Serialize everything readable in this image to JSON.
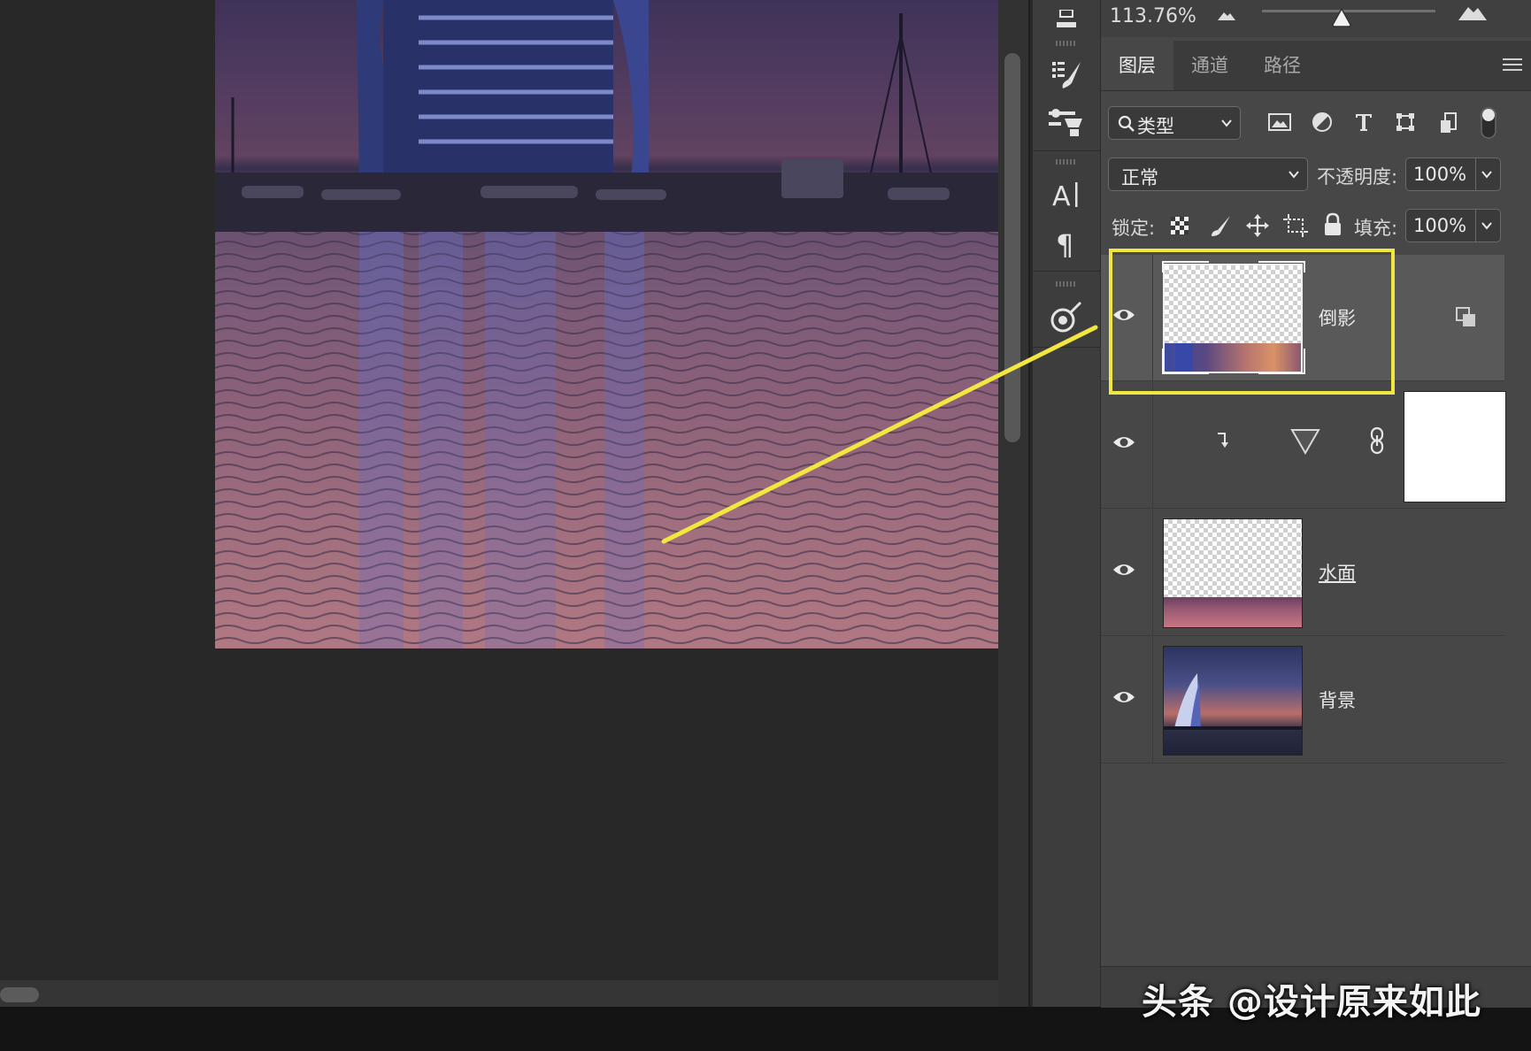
{
  "zoom": {
    "value": "113.76%",
    "slider_level": 0.46
  },
  "tabs": [
    {
      "label": "图层",
      "active": true
    },
    {
      "label": "通道",
      "active": false
    },
    {
      "label": "路径",
      "active": false
    }
  ],
  "filter": {
    "label": "类型",
    "icons": [
      "image-filter-icon",
      "adjustment-filter-icon",
      "type-filter-icon",
      "shape-filter-icon",
      "smart-object-filter-icon",
      "filter-toggle-icon"
    ]
  },
  "blend": {
    "mode": "正常",
    "opacity_label": "不透明度:",
    "opacity_value": "100%"
  },
  "lock": {
    "label": "锁定:",
    "fill_label": "填充:",
    "fill_value": "100%"
  },
  "layers": [
    {
      "name": "倒影",
      "selected": true,
      "underlined": false
    },
    {
      "name": "",
      "selected": false,
      "type": "adjustment-with-mask"
    },
    {
      "name": "水面",
      "selected": false,
      "underlined": true
    },
    {
      "name": "背景",
      "selected": false,
      "underlined": false
    }
  ],
  "watermark": "头条 @设计原来如此",
  "colors": {
    "highlight": "#f2e640",
    "panel_bg": "#474747",
    "selected_row": "#595959"
  }
}
